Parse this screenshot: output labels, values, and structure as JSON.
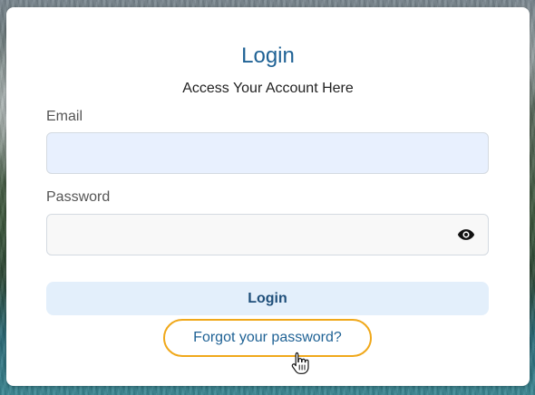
{
  "form": {
    "title": "Login",
    "subtitle": "Access Your Account Here",
    "email_label": "Email",
    "email_value": "",
    "password_label": "Password",
    "password_value": "",
    "login_label": "Login",
    "forgot_label": "Forgot your password?"
  },
  "icons": {
    "password_toggle": "eye-icon",
    "cursor": "hand-pointer-cursor-icon"
  },
  "colors": {
    "accent": "#1f6295",
    "email_field_bg": "#e8f0fe",
    "login_button_bg": "#e3effb",
    "focus_ring": "#f0a81a"
  }
}
